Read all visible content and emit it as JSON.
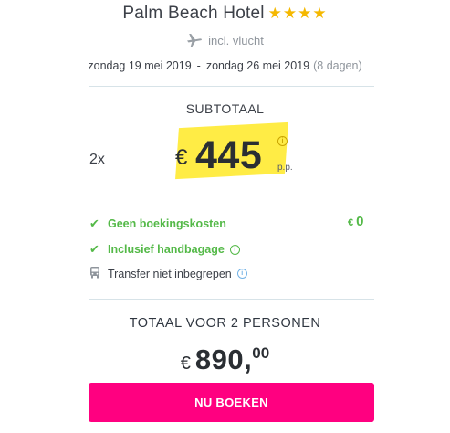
{
  "hotel": {
    "name": "Palm Beach Hotel",
    "stars": "★★★★",
    "star_rating": 4
  },
  "flight": {
    "label": "incl. vlucht",
    "icon": "plane-icon"
  },
  "dates": {
    "from": "zondag 19 mei 2019",
    "separator": "-",
    "to": "zondag 26 mei 2019",
    "nights": "(8 dagen)"
  },
  "subtotal": {
    "label": "SUBTOTAAL",
    "quantity": "2x",
    "currency": "€",
    "price": "445",
    "info": "i",
    "per_person": "p.p."
  },
  "features": [
    {
      "label": "Geen boekingskosten",
      "icon": "check-icon",
      "value_currency": "€",
      "value": "0"
    },
    {
      "label": "Inclusief handbagage",
      "icon": "check-icon",
      "info": "i"
    },
    {
      "label": "Transfer niet inbegrepen",
      "icon": "bus-icon",
      "info": "i"
    }
  ],
  "total": {
    "label": "TOTAAL VOOR 2 PERSONEN",
    "currency": "€",
    "integer": "890,",
    "decimals": "00"
  },
  "actions": {
    "book_label": "NU BOEKEN"
  },
  "colors": {
    "accent": "#ff0080",
    "success": "#54b948",
    "star": "#f5b800",
    "highlight": "#ffeb3b",
    "info": "#74b3e6"
  }
}
